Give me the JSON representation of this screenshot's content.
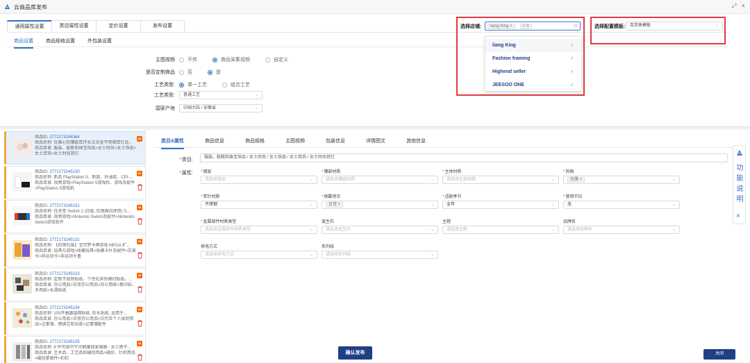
{
  "window": {
    "title": "云商品库发布",
    "controls": [
      "⤢",
      "×"
    ]
  },
  "top_tabs": [
    "通用属性设置",
    "类目属性设置",
    "定价设置",
    "发布设置"
  ],
  "sub_tabs": [
    "商品设置",
    "商品规格设置",
    "外包装设置"
  ],
  "settings": {
    "main_video": {
      "label": "主图视频",
      "options": [
        "不传",
        "商品采集视频",
        "自定义"
      ],
      "selected": "商品采集视频"
    },
    "customized": {
      "label": "是否定制商品",
      "options": [
        "否",
        "是"
      ],
      "selected": "是"
    },
    "craft_type": {
      "label": "工艺类型:",
      "options": [
        "单一工艺",
        "组合工艺"
      ],
      "selected": "单一工艺"
    },
    "craft_kind": {
      "label": "工艺类型:",
      "value": "普通工艺"
    },
    "origin": {
      "label": "国家产地",
      "value": "中国大陆 / 安徽省"
    }
  },
  "shop_select": {
    "label": "选择店铺:",
    "tag": "liang King",
    "tag_close": "×",
    "more": "+ 3",
    "options": [
      "liang King",
      "Fashion framing",
      "Highend seller",
      "JEESOO ONE"
    ],
    "check": "✓"
  },
  "template_select": {
    "label": "选择配置模板:",
    "value": "百货类模板"
  },
  "products": [
    {
      "id_label": "商品ID:",
      "id": "2772173244364",
      "name_label": "商品名称:",
      "name": "优雅心形镶嵌耳环女式合金不锈钢耳钉适...",
      "cat_label": "商品目录:",
      "cat": "服装、鞋靴和珠宝饰品>女士时尚>女士饰品>女士耳饰>女士时尚耳钉"
    },
    {
      "id_label": "商品ID:",
      "id": "2772173245130",
      "name_label": "商品名称:",
      "name": "新品 PlayStation 5、新款、纤薄款、CPI-...",
      "cat_label": "商品目录:",
      "cat": "视频游戏>PlayStation 5游戏机、游戏及配件>PlayStation 5游戏机"
    },
    {
      "id_label": "商品ID:",
      "id": "2772173245131",
      "name_label": "商品名称:",
      "name": "任天堂 Switch 2 (日版, 仅限国内使用) S...",
      "cat_label": "商品目录:",
      "cat": "视频游戏>Nintendo Switch及配件>Nintendo Switch游戏软件"
    },
    {
      "id_label": "商品ID:",
      "id": "2772173245132",
      "name_label": "商品名称:",
      "name": "【热销包装】宝可梦卡牌游戏 MEGA 扩...",
      "cat_label": "商品目录:",
      "cat": "玩具与游戏>收藏玩具>收藏卡片及配件>交易卡>非运动卡>非运动卡盒"
    },
    {
      "id_label": "商品ID:",
      "id": "2772173245133",
      "name_label": "商品名称:",
      "name": "定制不规则贴纸、个性化异形模切贴纸、...",
      "cat_label": "商品目录:",
      "cat": "办公用品>日常办公用品>办公用纸>复印纸、多用纸>水滑贴纸"
    },
    {
      "id_label": "商品ID:",
      "id": "2772173245134",
      "name_label": "商品名称:",
      "name": "100开着趣谐网贴纸, 防水贴纸, 适用于...",
      "cat_label": "商品目录:",
      "cat": "办公用品>日常办公用品>日历及个人规划用品>记事簿、替换芯和封皮>记事簿配件"
    },
    {
      "id_label": "商品ID:",
      "id": "2772173245135",
      "name_label": "商品名称:",
      "name": "6 件可调节牛仔裤腰部紧缩器 - 女士裤子...",
      "cat_label": "商品目录:",
      "cat": "艺术品、工艺品和缝纫用品>缝纫、针织用品>缝纫紧固件>扣扣"
    }
  ],
  "right_tabs": [
    "类目&属性",
    "商品信息",
    "商品规格",
    "主图视频",
    "包装信息",
    "详情图文",
    "其他信息"
  ],
  "category": {
    "label": "类目:",
    "value": "服装、鞋靴和珠宝饰品 / 女士时尚 / 女士饰品 / 女士耳饰 / 女士时尚耳钉"
  },
  "attributes_label": "属性:",
  "attributes": [
    {
      "label": "镀层",
      "required": true,
      "value": "请选择镀层",
      "filled": false
    },
    {
      "label": "镶嵌材质",
      "required": true,
      "value": "请选择镶嵌材质",
      "filled": false
    },
    {
      "label": "主体材质",
      "required": true,
      "value": "请选择主体材质",
      "filled": false
    },
    {
      "label": "风格",
      "required": true,
      "value": "优雅",
      "filled": true,
      "tag": true
    },
    {
      "label": "耳针材质",
      "required": true,
      "value": "不锈钢",
      "filled": true
    },
    {
      "label": "佩戴场合",
      "required": true,
      "value": "日常",
      "filled": true,
      "tag": true
    },
    {
      "label": "适配季节",
      "required": true,
      "value": "全年",
      "filled": true
    },
    {
      "label": "营销节日",
      "required": true,
      "value": "无",
      "filled": true
    },
    {
      "label": "金属部件材质类型",
      "required": true,
      "value": "请选择金属部件材质类型",
      "filled": false
    },
    {
      "label": "诞生石",
      "required": false,
      "value": "请选择诞生石",
      "filled": false
    },
    {
      "label": "主题",
      "required": false,
      "value": "请选择主题",
      "filled": false
    },
    {
      "label": "品牌名",
      "required": false,
      "value": "请选择品牌名",
      "filled": false
    },
    {
      "label": "供电方式",
      "required": false,
      "value": "请选择供电方式",
      "filled": false
    },
    {
      "label": "系列线",
      "required": false,
      "value": "请选择系列线",
      "filled": false
    }
  ],
  "side_panel": {
    "text": "功能说明",
    "close": "×"
  },
  "buttons": {
    "publish": "确认发布",
    "close": "关闭"
  },
  "colors": {
    "accent": "#2f6fc9",
    "dark_button": "#1f3f86",
    "highlight_border": "#e0393e",
    "product_marker": "#f0a93a"
  }
}
